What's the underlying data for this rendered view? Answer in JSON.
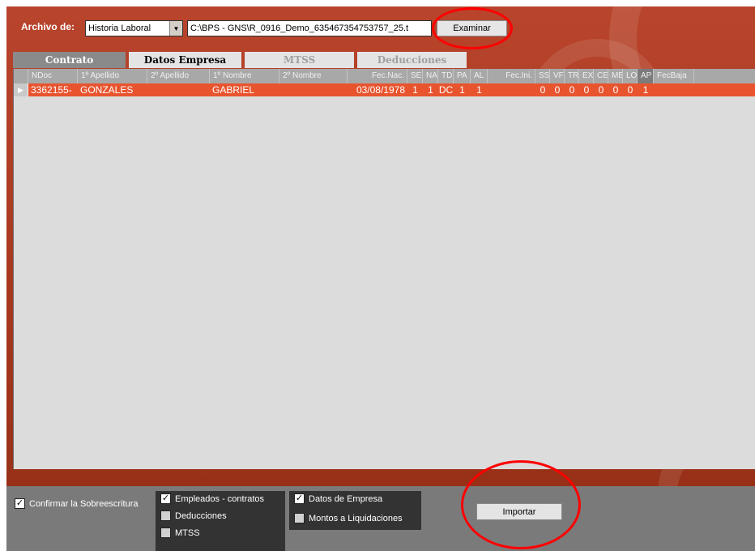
{
  "toolbar": {
    "archivo_label": "Archivo de:",
    "archivo_selected": "Historia Laboral",
    "path_value": "C:\\BPS - GNS\\R_0916_Demo_635467354753757_25.t",
    "examinar_label": "Examinar"
  },
  "tabs": [
    {
      "label": "Contrato",
      "state": "active"
    },
    {
      "label": "Datos Empresa",
      "state": "enabled"
    },
    {
      "label": "MTSS",
      "state": "disabled"
    },
    {
      "label": "Deducciones",
      "state": "disabled"
    }
  ],
  "grid": {
    "columns": [
      "NDoc",
      "1º Apellido",
      "2º Apellido",
      "1º Nombre",
      "2º Nombre",
      "Fec.Nac.",
      "SE",
      "NA",
      "TD",
      "PA",
      "AL",
      "Fec.Ini.",
      "SS",
      "VF",
      "TR",
      "EX",
      "CE",
      "MB",
      "LO",
      "AP",
      "FecBaja"
    ],
    "rows": [
      {
        "ndoc": "3362155-",
        "apellido1": "GONZALES",
        "apellido2": "",
        "nombre1": "GABRIEL",
        "nombre2": "",
        "fec_nac": "03/08/1978",
        "se": "1",
        "na": "1",
        "td": "DC",
        "pa": "1",
        "al": "1",
        "fec_ini": "",
        "ss": "0",
        "vf": "0",
        "tr": "0",
        "ex": "0",
        "ce": "0",
        "mb": "0",
        "lo": "0",
        "ap": "1",
        "fec_baja": ""
      }
    ]
  },
  "options": {
    "confirmar": {
      "label": "Confirmar la Sobreescritura",
      "checked": true
    },
    "empleados": {
      "label": "Empleados - contratos",
      "checked": true
    },
    "deducciones": {
      "label": "Deducciones",
      "checked": false
    },
    "mtss": {
      "label": "MTSS",
      "checked": false
    },
    "datos_empresa": {
      "label": "Datos de Empresa",
      "checked": true
    },
    "montos": {
      "label": "Montos a Liquidaciones",
      "checked": false
    }
  },
  "importar_label": "Importar",
  "colors": {
    "panel_red": "#b8442c",
    "row_selected": "#e8542e",
    "highlight_ring": "#ff0000",
    "bottom_gray": "#7a7a7a"
  },
  "icons": {
    "dropdown": "chevron-down-icon",
    "row_indicator": "row-pointer-icon",
    "checkbox": "check-icon"
  }
}
